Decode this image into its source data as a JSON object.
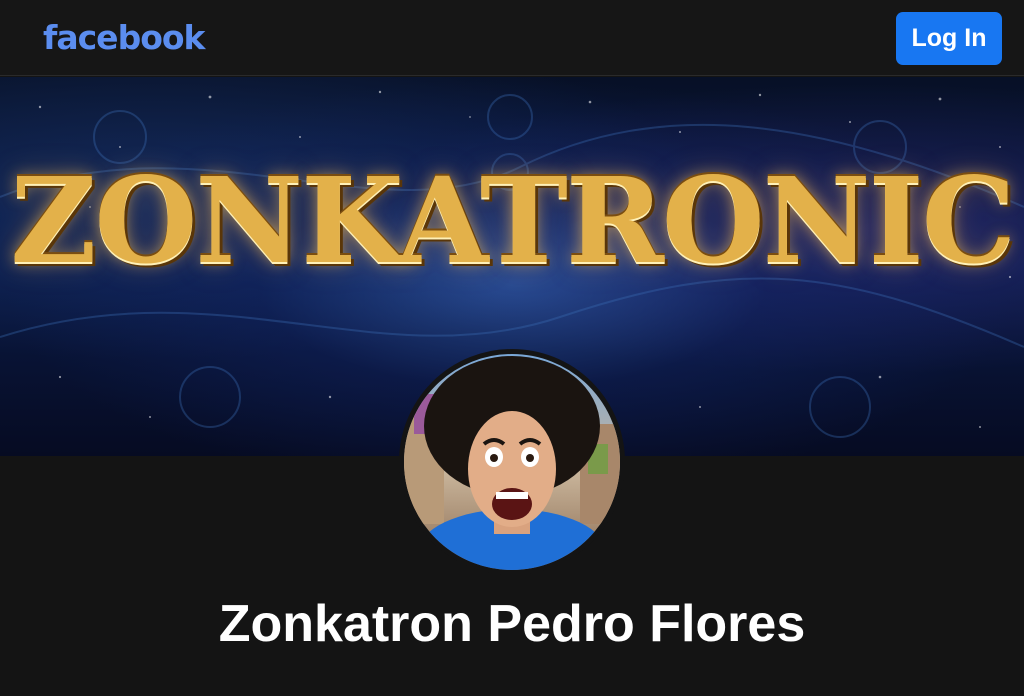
{
  "header": {
    "logo_text": "facebook",
    "login_label": "Log In"
  },
  "cover": {
    "title_text": "ZONKATRONIC"
  },
  "profile": {
    "name": "Zonkatron Pedro Flores"
  },
  "colors": {
    "background": "#141414",
    "brand_blue": "#1877f2",
    "logo_blue": "#5b8def",
    "cover_gold": "#e3b14a"
  }
}
